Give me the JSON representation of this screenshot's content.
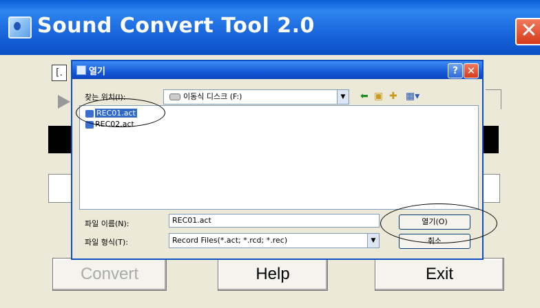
{
  "window": {
    "title": "Sound Convert Tool 2.0",
    "close_glyph": "✕"
  },
  "background": {
    "small_button_label": "[.",
    "buttons": {
      "convert": "Convert",
      "help": "Help",
      "exit": "Exit"
    }
  },
  "dialog": {
    "title": "열기",
    "help_glyph": "?",
    "close_glyph": "✕",
    "look_in_label": "찾는 위치(I):",
    "look_in_value": "이동식 디스크 (F:)",
    "toolbar": {
      "back_icon": "back-arrow-icon",
      "up_icon": "up-folder-icon",
      "new_folder_icon": "new-folder-icon",
      "view_icon": "view-menu-icon"
    },
    "files": [
      {
        "name": "REC01.act",
        "selected": true
      },
      {
        "name": "REC02.act",
        "selected": false
      }
    ],
    "file_name_label": "파일 이름(N):",
    "file_name_value": "REC01.act",
    "file_type_label": "파일 형식(T):",
    "file_type_value": "Record Files(*.act; *.rcd; *.rec)",
    "open_button": "열기(O)",
    "cancel_button": "취소"
  },
  "colors": {
    "title_bar": "#0a5fd6",
    "selection": "#316ac5",
    "close_button": "#d43b1a"
  }
}
